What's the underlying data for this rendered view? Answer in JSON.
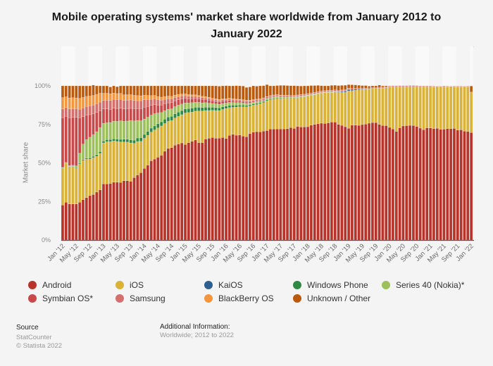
{
  "chart_data": {
    "type": "bar",
    "stacked": true,
    "title": "Mobile operating systems' market share worldwide from January 2012 to January 2022",
    "xlabel": "",
    "ylabel": "Market share",
    "ylim": [
      0,
      100
    ],
    "y_ticks": [
      "0%",
      "25%",
      "50%",
      "75%",
      "100%"
    ],
    "y_tick_values": [
      0,
      25,
      50,
      75,
      100
    ],
    "grid": false,
    "legend_position": "bottom",
    "x_tick_labels": [
      "Jan '12",
      "May '12",
      "Sep '12",
      "Jan '13",
      "May '13",
      "Sep '13",
      "Jan '14",
      "May '14",
      "Sep '14",
      "Jan '15",
      "May '15",
      "Sep '15",
      "Jan '16",
      "May '16",
      "Sep '16",
      "Jan '17",
      "May '17",
      "Sep '17",
      "Jan '18",
      "May '18",
      "Sep '18",
      "Jan '19",
      "May '19",
      "Sep '19",
      "Jan '20",
      "May '20",
      "Sep '20",
      "Jan '21",
      "May '21",
      "Sep '21",
      "Jan '22"
    ],
    "x_tick_every": 4,
    "x_start": "Jan 2012",
    "x_end": "Jan 2022",
    "x_count": 121,
    "series": [
      {
        "name": "Android",
        "color": "#b8342b",
        "values": [
          22.7,
          24.5,
          23.4,
          23.4,
          23.4,
          24.5,
          26.2,
          27.5,
          28.8,
          29.5,
          31.1,
          32.6,
          36.4,
          36.4,
          36.7,
          37.5,
          37.5,
          37.4,
          38.5,
          38.5,
          38.1,
          40.5,
          42.2,
          43.7,
          46.5,
          48.6,
          51.4,
          52.5,
          53.7,
          55.0,
          57.6,
          59.4,
          60.0,
          61.5,
          62.3,
          63.0,
          62.0,
          63.2,
          64.0,
          64.9,
          63.2,
          63.2,
          65.5,
          66.0,
          66.5,
          66.0,
          66.1,
          66.5,
          65.9,
          67.9,
          68.6,
          68.0,
          68.1,
          67.4,
          67.0,
          69.0,
          70.0,
          70.3,
          70.2,
          70.7,
          71.0,
          72.0,
          72.0,
          72.1,
          72.1,
          72.1,
          72.2,
          73.0,
          72.4,
          73.7,
          73.3,
          73.4,
          73.5,
          74.5,
          75.0,
          75.4,
          75.8,
          75.6,
          76.0,
          76.5,
          76.5,
          75.0,
          74.4,
          73.5,
          72.5,
          74.5,
          74.5,
          74.4,
          74.9,
          75.2,
          75.8,
          76.2,
          76.2,
          75.0,
          74.3,
          74.2,
          73.1,
          72.0,
          70.5,
          72.8,
          74.0,
          74.2,
          74.4,
          74.3,
          73.7,
          72.6,
          71.6,
          72.8,
          72.7,
          72.3,
          72.5,
          71.8,
          71.9,
          72.3,
          72.2,
          72.4,
          71.3,
          71.5,
          70.6,
          70.4,
          69.7
        ]
      },
      {
        "name": "iOS",
        "color": "#dab237",
        "values": [
          24.0,
          25.3,
          24.2,
          24.2,
          23.3,
          24.8,
          25.4,
          24.9,
          23.6,
          23.9,
          23.2,
          23.6,
          26.6,
          27.4,
          27.1,
          26.7,
          26.4,
          26.2,
          25.1,
          25.0,
          24.9,
          22.2,
          21.7,
          20.3,
          19.5,
          19.3,
          18.6,
          18.9,
          19.0,
          19.0,
          18.0,
          17.6,
          17.5,
          17.6,
          17.9,
          18.3,
          20.4,
          19.5,
          19.0,
          18.7,
          20.5,
          20.5,
          18.5,
          18.0,
          17.6,
          18.0,
          17.9,
          18.2,
          19.4,
          18.0,
          17.5,
          18.2,
          18.3,
          19.0,
          19.4,
          17.8,
          17.5,
          17.6,
          18.2,
          18.4,
          19.3,
          19.0,
          19.5,
          19.8,
          19.5,
          19.6,
          19.6,
          18.8,
          19.6,
          18.6,
          19.2,
          19.5,
          20.0,
          19.4,
          19.2,
          19.4,
          19.5,
          20.0,
          19.8,
          19.3,
          19.5,
          20.7,
          21.5,
          22.5,
          24.3,
          22.4,
          22.7,
          23.1,
          22.8,
          22.6,
          22.2,
          22.0,
          22.1,
          23.5,
          24.3,
          24.6,
          26.2,
          27.4,
          28.9,
          26.7,
          25.5,
          25.3,
          25.2,
          25.2,
          25.8,
          26.8,
          27.8,
          26.6,
          26.7,
          27.0,
          26.7,
          27.4,
          27.5,
          27.0,
          27.0,
          26.9,
          28.0,
          27.8,
          28.6,
          28.9,
          25.8
        ]
      },
      {
        "name": "KaiOS",
        "color": "#2f5f8f",
        "values": [
          0,
          0,
          0,
          0,
          0,
          0,
          0,
          0,
          0,
          0,
          0,
          0,
          0,
          0,
          0,
          0,
          0,
          0,
          0,
          0,
          0,
          0,
          0,
          0,
          0,
          0,
          0,
          0,
          0,
          0,
          0,
          0,
          0,
          0,
          0,
          0,
          0,
          0,
          0,
          0,
          0,
          0,
          0,
          0,
          0,
          0,
          0,
          0,
          0,
          0,
          0,
          0,
          0,
          0,
          0,
          0,
          0,
          0,
          0,
          0,
          0,
          0,
          0,
          0,
          0,
          0,
          0,
          0,
          0,
          0,
          0,
          0,
          0,
          0,
          0,
          0,
          0,
          0,
          0,
          0,
          0.2,
          0.4,
          0.6,
          0.7,
          0.9,
          0.8,
          0.6,
          0.5,
          0.3,
          0.2,
          0.1,
          0.1,
          0.1,
          0.1,
          0.1,
          0.1,
          0.1,
          0.1,
          0.1,
          0.1,
          0.1,
          0.1,
          0.1,
          0.1,
          0.1,
          0.1,
          0.1,
          0.1,
          0.1,
          0.1,
          0.1,
          0.1,
          0.1,
          0.1,
          0.1,
          0.1,
          0.1,
          0.1,
          0.1,
          0.1,
          0.1
        ]
      },
      {
        "name": "Windows Phone",
        "color": "#2e8a42",
        "values": [
          0.3,
          0.3,
          0.3,
          0.3,
          0.4,
          0.5,
          0.6,
          0.7,
          0.8,
          0.9,
          1.0,
          1.1,
          1.2,
          1.3,
          1.4,
          1.5,
          1.6,
          1.7,
          1.8,
          1.9,
          2.0,
          2.1,
          2.3,
          2.4,
          2.5,
          2.6,
          2.6,
          2.6,
          2.7,
          2.7,
          2.8,
          2.8,
          2.8,
          2.8,
          2.8,
          2.7,
          2.7,
          2.6,
          2.6,
          2.5,
          2.4,
          2.3,
          2.2,
          2.1,
          2.0,
          1.9,
          1.8,
          1.7,
          1.6,
          1.5,
          1.4,
          1.3,
          1.2,
          1.1,
          1.0,
          0.9,
          0.8,
          0.8,
          0.7,
          0.7,
          0.6,
          0.6,
          0.5,
          0.5,
          0.5,
          0.4,
          0.4,
          0.4,
          0.3,
          0.3,
          0.3,
          0.2,
          0.2,
          0.2,
          0.2,
          0.2,
          0.1,
          0.1,
          0.1,
          0.1,
          0.1,
          0.1,
          0.1,
          0.1,
          0.1,
          0,
          0,
          0,
          0,
          0,
          0,
          0,
          0,
          0,
          0,
          0,
          0,
          0,
          0,
          0,
          0,
          0,
          0,
          0,
          0,
          0,
          0,
          0,
          0,
          0,
          0,
          0,
          0,
          0,
          0,
          0,
          0,
          0,
          0,
          0,
          0
        ]
      },
      {
        "name": "Series 40 (Nokia)*",
        "color": "#9cc05b",
        "values": [
          0.1,
          0.2,
          0.4,
          0.6,
          1.0,
          6.5,
          10.0,
          12.0,
          13.5,
          14.0,
          15.0,
          15.6,
          11.5,
          11.0,
          11.0,
          11.4,
          11.5,
          12.0,
          11.6,
          11.8,
          12.5,
          12.5,
          11.4,
          11.0,
          10.0,
          9.2,
          8.4,
          8.0,
          7.0,
          6.0,
          5.5,
          5.0,
          4.8,
          4.6,
          4.5,
          4.2,
          3.8,
          3.6,
          3.5,
          3.3,
          3.2,
          3.0,
          2.9,
          2.7,
          2.5,
          2.4,
          2.3,
          2.2,
          2.0,
          1.9,
          1.7,
          1.6,
          1.5,
          1.4,
          1.3,
          1.2,
          1.1,
          1.0,
          0.9,
          0.8,
          0.8,
          0.7,
          0.7,
          0.6,
          0.6,
          0.5,
          0.5,
          0.5,
          0.5,
          0.4,
          0.4,
          0.4,
          0.3,
          0.3,
          0.3,
          0.3,
          0.2,
          0.2,
          0.2,
          0.2,
          0.1,
          0.1,
          0.1,
          0.1,
          0.1,
          0,
          0,
          0,
          0,
          0,
          0,
          0,
          0,
          0,
          0,
          0,
          0,
          0,
          0,
          0,
          0,
          0,
          0,
          0,
          0,
          0,
          0,
          0,
          0,
          0,
          0,
          0,
          0,
          0,
          0,
          0,
          0,
          0,
          0,
          0,
          0
        ]
      },
      {
        "name": "Symbian OS*",
        "color": "#c9494a",
        "values": [
          32.3,
          30.0,
          31.0,
          31.0,
          31.5,
          23.0,
          17.8,
          15.8,
          14.6,
          13.5,
          12.5,
          11.0,
          9.3,
          8.9,
          8.6,
          8.4,
          8.3,
          8.2,
          8.0,
          8.0,
          7.9,
          7.9,
          7.6,
          7.9,
          7.7,
          7.0,
          6.3,
          5.8,
          5.2,
          4.9,
          4.5,
          4.2,
          4.0,
          3.7,
          3.5,
          3.3,
          3.0,
          2.8,
          2.6,
          2.4,
          2.3,
          2.2,
          2.0,
          1.9,
          1.7,
          1.6,
          1.5,
          1.4,
          1.3,
          1.2,
          1.1,
          1.0,
          0.9,
          0.8,
          0.8,
          0.7,
          0.6,
          0.6,
          0.5,
          0.5,
          0.4,
          0.4,
          0.4,
          0.3,
          0.3,
          0.3,
          0.3,
          0.2,
          0.2,
          0.2,
          0.2,
          0.2,
          0.1,
          0.1,
          0.1,
          0.1,
          0.1,
          0.1,
          0.1,
          0.1,
          0.1,
          0.1,
          0.1,
          0.1,
          0.1,
          0,
          0,
          0,
          0,
          0,
          0,
          0,
          0,
          0,
          0,
          0,
          0,
          0,
          0,
          0,
          0,
          0,
          0,
          0,
          0,
          0,
          0,
          0,
          0,
          0,
          0,
          0,
          0,
          0,
          0,
          0,
          0,
          0,
          0,
          0,
          0
        ]
      },
      {
        "name": "Samsung",
        "color": "#d46f6c",
        "values": [
          5.6,
          5.6,
          5.7,
          5.7,
          5.6,
          5.6,
          5.7,
          5.7,
          5.8,
          5.8,
          5.7,
          5.6,
          5.6,
          5.7,
          5.8,
          5.8,
          5.8,
          5.8,
          5.6,
          5.6,
          5.5,
          5.3,
          5.2,
          5.1,
          4.8,
          4.4,
          4.0,
          3.8,
          3.5,
          3.2,
          2.9,
          2.7,
          2.5,
          2.3,
          2.1,
          1.9,
          1.7,
          1.6,
          1.5,
          1.4,
          1.3,
          1.2,
          1.1,
          1.1,
          1.0,
          1.0,
          1.0,
          1.0,
          0.9,
          0.9,
          0.9,
          0.9,
          0.9,
          0.9,
          0.8,
          0.8,
          0.8,
          0.8,
          0.8,
          0.8,
          0.8,
          0.8,
          0.8,
          0.8,
          0.8,
          0.8,
          0.8,
          0.8,
          0.8,
          0.8,
          0.8,
          0.8,
          0.8,
          0.8,
          0.8,
          0.8,
          0.8,
          0.8,
          0.8,
          0.8,
          0.8,
          0.7,
          0.7,
          0.7,
          0.6,
          0.6,
          0.6,
          0.6,
          0.6,
          0.6,
          0.6,
          0.6,
          0.5,
          0.5,
          0.5,
          0.5,
          0.5,
          0.5,
          0.5,
          0.5,
          0.5,
          0.5,
          0.5,
          0.5,
          0.5,
          0.4,
          0.4,
          0.4,
          0.4,
          0.4,
          0.4,
          0.4,
          0.4,
          0.4,
          0.4,
          0.4,
          0.4,
          0.4,
          0.4,
          0.4,
          0.4
        ]
      },
      {
        "name": "BlackBerry OS",
        "color": "#f4963e",
        "values": [
          7.4,
          7.0,
          7.2,
          7.1,
          7.0,
          7.0,
          6.8,
          6.6,
          6.3,
          6.2,
          6.0,
          5.7,
          4.6,
          4.5,
          4.3,
          4.0,
          3.9,
          3.8,
          3.6,
          3.5,
          3.4,
          3.4,
          3.3,
          3.2,
          3.0,
          2.7,
          2.4,
          2.2,
          2.0,
          1.9,
          1.8,
          1.7,
          1.6,
          1.5,
          1.4,
          1.3,
          1.2,
          1.1,
          1.0,
          1.0,
          0.9,
          0.9,
          0.8,
          0.8,
          0.7,
          0.7,
          0.6,
          0.6,
          0.5,
          0.5,
          0.5,
          0.4,
          0.4,
          0.4,
          0.4,
          0.3,
          0.3,
          0.3,
          0.3,
          0.3,
          0.2,
          0.2,
          0.2,
          0.2,
          0.2,
          0.2,
          0.2,
          0.1,
          0.1,
          0.1,
          0.1,
          0.1,
          0.1,
          0.1,
          0.1,
          0.1,
          0.1,
          0.1,
          0.1,
          0.1,
          0.1,
          0,
          0,
          0,
          0,
          0,
          0,
          0,
          0,
          0,
          0,
          0,
          0,
          0,
          0,
          0,
          0,
          0,
          0,
          0,
          0,
          0,
          0,
          0,
          0,
          0,
          0,
          0,
          0,
          0,
          0,
          0,
          0,
          0,
          0,
          0,
          0,
          0,
          0,
          0,
          0
        ]
      },
      {
        "name": "Unknown / Other",
        "color": "#bb5a0d",
        "values": [
          7.6,
          7.1,
          7.8,
          7.7,
          7.8,
          8.1,
          7.5,
          6.8,
          6.6,
          6.7,
          5.5,
          4.8,
          4.8,
          4.8,
          4.4,
          4.7,
          4.5,
          4.9,
          5.8,
          5.7,
          5.7,
          6.1,
          6.3,
          6.4,
          6.0,
          6.2,
          6.3,
          6.2,
          6.9,
          7.3,
          6.9,
          6.6,
          6.8,
          6.0,
          5.5,
          5.3,
          5.2,
          5.6,
          5.8,
          5.8,
          6.2,
          6.7,
          7.0,
          7.4,
          8.0,
          8.4,
          8.6,
          8.4,
          8.5,
          8.1,
          8.3,
          8.7,
          8.7,
          8.9,
          8.3,
          8.6,
          8.9,
          8.4,
          8.4,
          7.9,
          7.7,
          6.3,
          5.9,
          5.9,
          6.3,
          6.4,
          6.2,
          6.3,
          6.2,
          5.9,
          5.6,
          5.4,
          5.0,
          4.8,
          4.5,
          4.0,
          3.5,
          3.1,
          2.9,
          3.2,
          3.0,
          3.1,
          2.8,
          2.7,
          2.2,
          2.4,
          2.2,
          1.8,
          1.6,
          1.6,
          1.1,
          1.1,
          1.1,
          1.4,
          0.8,
          0.6,
          0.1,
          0.1,
          0.1,
          0.1,
          0.1,
          0.1,
          0.1,
          0.2,
          0.1,
          0.1,
          0.1,
          0.1,
          0.1,
          0.1,
          0.1,
          0.1,
          0.1,
          0.1,
          0.1,
          0.1,
          0.1,
          0.1,
          0.1,
          0.1,
          3.9
        ]
      }
    ]
  },
  "legend": [
    {
      "label": "Android",
      "color": "#b8342b"
    },
    {
      "label": "iOS",
      "color": "#dab237"
    },
    {
      "label": "KaiOS",
      "color": "#2f5f8f"
    },
    {
      "label": "Windows Phone",
      "color": "#2e8a42"
    },
    {
      "label": "Series 40 (Nokia)*",
      "color": "#9cc05b"
    },
    {
      "label": "Symbian OS*",
      "color": "#c9494a"
    },
    {
      "label": "Samsung",
      "color": "#d46f6c"
    },
    {
      "label": "BlackBerry OS",
      "color": "#f4963e"
    },
    {
      "label": "Unknown / Other",
      "color": "#bb5a0d"
    }
  ],
  "footer": {
    "source_title": "Source",
    "source_name": "StatCounter",
    "copyright": "© Statista 2022",
    "additional_title": "Additional Information:",
    "additional_text": "Worldwide; 2012 to 2022"
  }
}
